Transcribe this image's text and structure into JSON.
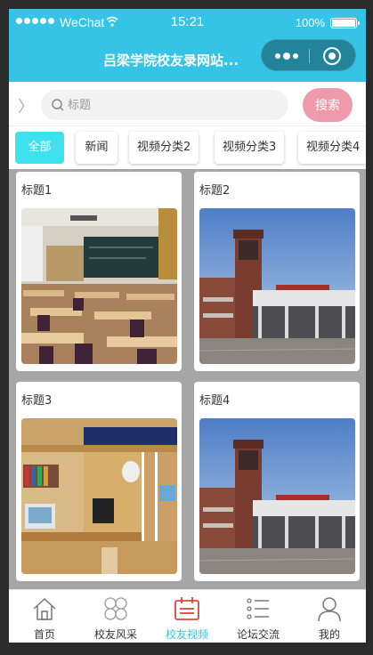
{
  "status_bar": {
    "carrier": "WeChat",
    "time": "15:21",
    "battery": "100%"
  },
  "header": {
    "title": "吕梁学院校友录网站..."
  },
  "search": {
    "placeholder": "标题",
    "value": "",
    "button_label": "搜索"
  },
  "categories": {
    "active_index": 0,
    "items": [
      "全部",
      "新闻",
      "视频分类2",
      "视频分类3",
      "视频分类4"
    ]
  },
  "cards": [
    {
      "title": "标题1",
      "image": "classroom-image"
    },
    {
      "title": "标题2",
      "image": "building-image"
    },
    {
      "title": "标题3",
      "image": "dorm-image"
    },
    {
      "title": "标题4",
      "image": "building-image"
    }
  ],
  "tabbar": {
    "active_index": 2,
    "items": [
      {
        "label": "首页",
        "icon": "home-icon"
      },
      {
        "label": "校友风采",
        "icon": "clover-icon"
      },
      {
        "label": "校友视频",
        "icon": "video-icon"
      },
      {
        "label": "论坛交流",
        "icon": "list-icon"
      },
      {
        "label": "我的",
        "icon": "user-icon"
      }
    ]
  },
  "colors": {
    "header": "#35c4e6",
    "search_button": "#ee9aaa",
    "active_category": "#3ee2ee",
    "active_tab_icon": "#e0453a",
    "active_tab_label": "#35c4e6"
  }
}
